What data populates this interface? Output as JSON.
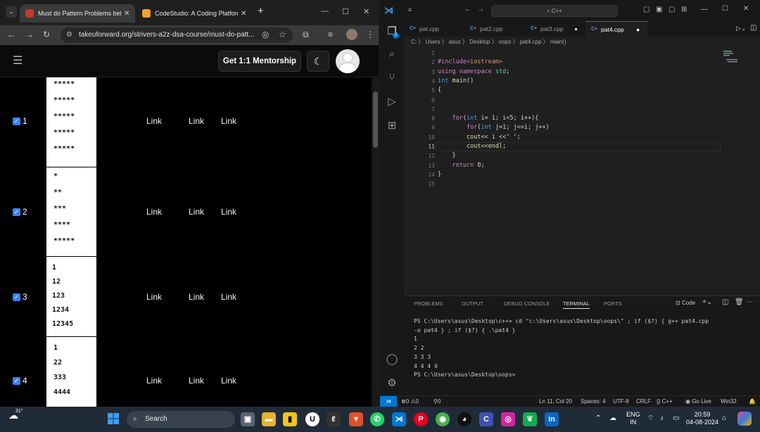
{
  "browser": {
    "tabs": [
      {
        "label": "Must do Pattern Problems befo",
        "icon": "tuf-favicon",
        "close": "✕"
      },
      {
        "label": "CodeStudio: A Coding Platform",
        "icon": "codestudio-favicon",
        "close": "✕"
      }
    ],
    "new_tab": "+",
    "url": "takeuforward.org/strivers-a2z-dsa-course/must-do-patt...",
    "header": {
      "mentorship_button": "Get 1:1 Mentorship"
    },
    "patterns": [
      {
        "num": "1",
        "lines": [
          "*****",
          "*****",
          "*****",
          "*****",
          "*****"
        ],
        "links": [
          "Link",
          "Link",
          "Link"
        ]
      },
      {
        "num": "2",
        "lines": [
          "*",
          "**",
          "***",
          "****",
          "*****"
        ],
        "links": [
          "Link",
          "Link",
          "Link"
        ]
      },
      {
        "num": "3",
        "lines": [
          "1",
          "12",
          "123",
          "1234",
          "12345"
        ],
        "links": [
          "Link",
          "Link",
          "Link"
        ]
      },
      {
        "num": "4",
        "lines": [
          "1",
          "22",
          "333",
          "4444"
        ],
        "links": [
          "Link",
          "Link",
          "Link"
        ]
      }
    ]
  },
  "vscode": {
    "search_placeholder": "C++",
    "tabs": [
      "pat.cpp",
      "pat2.cpp",
      "pat3.cpp",
      "pat4.cpp"
    ],
    "breadcrumb": "C: 〉 Users 〉 asus 〉 Desktop 〉 oops 〉 pat4.cpp 〉 main()",
    "code": [
      {
        "n": "1",
        "text": ""
      },
      {
        "n": "2",
        "text": "#include<iostream>"
      },
      {
        "n": "3",
        "text": "using namespace std;"
      },
      {
        "n": "4",
        "text": "int main()"
      },
      {
        "n": "5",
        "text": "{"
      },
      {
        "n": "6",
        "text": ""
      },
      {
        "n": "7",
        "text": ""
      },
      {
        "n": "8",
        "text": "    for(int i= 1; i<5; i++){"
      },
      {
        "n": "9",
        "text": "        for(int j=1; j<=i; j++)"
      },
      {
        "n": "10",
        "text": "        cout<< i <<\" \";"
      },
      {
        "n": "11",
        "text": "        cout<<endl;"
      },
      {
        "n": "12",
        "text": "    }"
      },
      {
        "n": "13",
        "text": "    return 0;"
      },
      {
        "n": "14",
        "text": "}"
      },
      {
        "n": "15",
        "text": ""
      }
    ],
    "panel_tabs": [
      "PROBLEMS",
      "OUTPUT",
      "DEBUG CONSOLE",
      "TERMINAL",
      "PORTS"
    ],
    "panel_shell": "Code",
    "terminal": [
      "PS C:\\Users\\asus\\Desktop\\c++> cd \"c:\\Users\\asus\\Desktop\\oops\\\" ; if ($?) { g++ pat4.cpp",
      "-o pat4 } ; if ($?) { .\\pat4 }",
      "1",
      "2 2",
      "3 3 3",
      "4 4 4 4",
      "PS C:\\Users\\asus\\Desktop\\oops>"
    ],
    "status": {
      "errors": "⊗0 ⚠0",
      "ports": "⚲0",
      "position": "Ln 11, Col 20",
      "spaces": "Spaces: 4",
      "encoding": "UTF-8",
      "eol": "CRLF",
      "language": "{} C++",
      "golive": "Go Live",
      "platform": "Win32"
    }
  },
  "taskbar": {
    "weather": "31°",
    "search": "Search",
    "lang": [
      "ENG",
      "IN"
    ],
    "time": "20:59",
    "date": "04-08-2024"
  }
}
